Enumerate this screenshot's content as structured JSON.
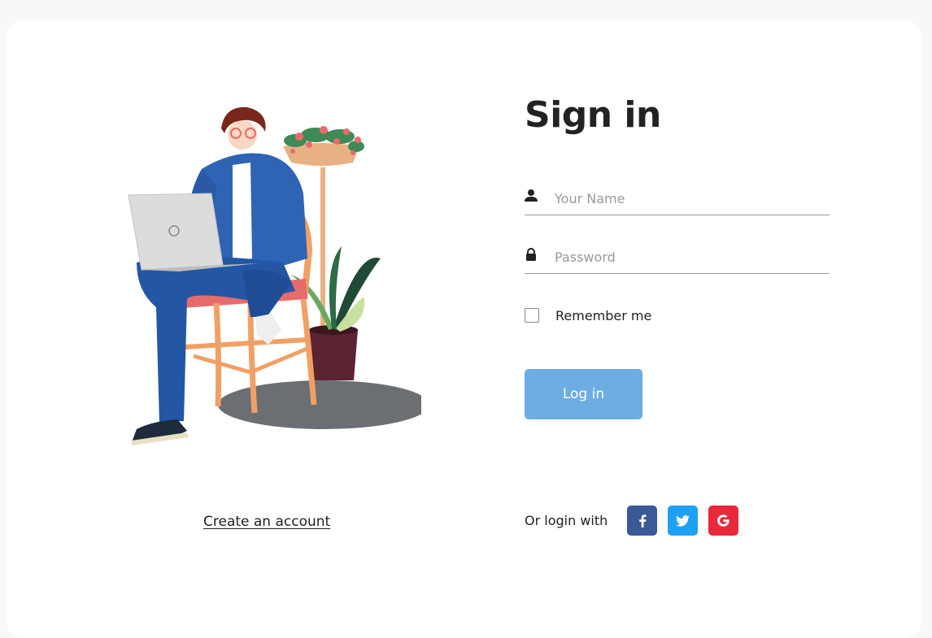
{
  "form": {
    "title": "Sign in",
    "name_placeholder": "Your Name",
    "password_placeholder": "Password",
    "remember_label": "Remember me",
    "login_label": "Log in"
  },
  "links": {
    "create_account": "Create an account"
  },
  "social": {
    "label": "Or login with",
    "providers": [
      {
        "name": "facebook",
        "color": "#3b5998"
      },
      {
        "name": "twitter",
        "color": "#1da1f2"
      },
      {
        "name": "google",
        "color": "#e8283b"
      }
    ]
  },
  "colors": {
    "accent": "#6dade3",
    "text": "#222222"
  }
}
